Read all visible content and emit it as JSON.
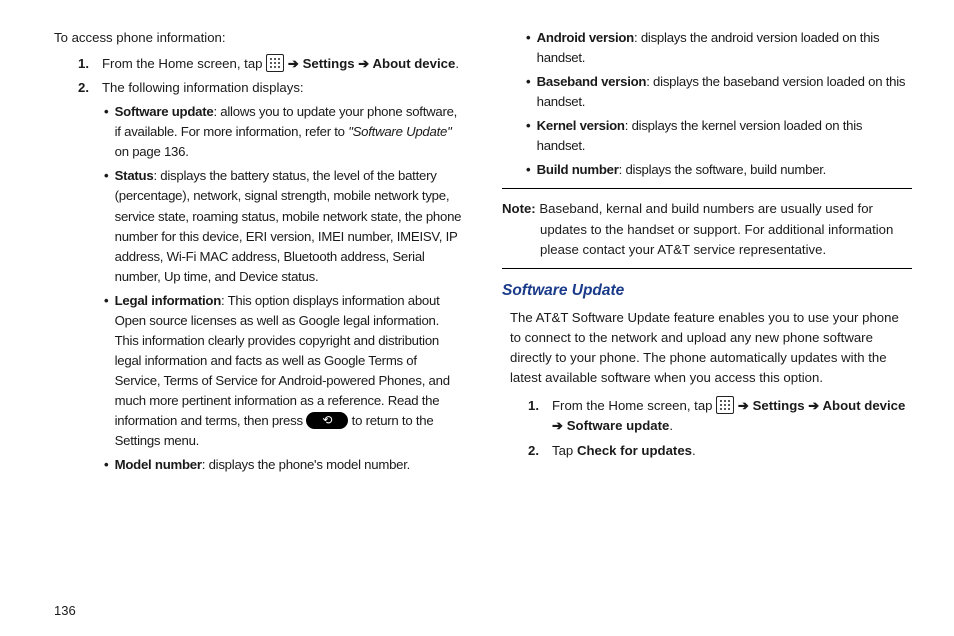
{
  "page_number": "136",
  "left": {
    "intro": "To access phone information:",
    "step1_pre": "From the Home screen, tap ",
    "step1_post1": " Settings ",
    "step1_post2": " About device",
    "step2": "The following information displays:",
    "bullets": [
      {
        "label": "Software update",
        "text": ": allows you to update your phone software, if available. For more information, refer to ",
        "ref": "\"Software Update\"",
        "tail": " on page 136."
      },
      {
        "label": "Status",
        "text": ": displays the battery status, the level of the battery (percentage), network, signal strength, mobile network type, service state, roaming status, mobile network state, the phone number for this device, ERI version, IMEI number, IMEISV, IP address, Wi-Fi MAC address, Bluetooth address, Serial number, Up time, and Device status."
      },
      {
        "label": "Legal information",
        "text": ": This option displays information about Open source licenses as well as Google legal information. This information clearly provides copyright and distribution legal information and facts as well as Google Terms of Service, Terms of Service for Android-powered Phones, and much more pertinent information as a reference. Read the information and terms, then press ",
        "tail2": " to return to the Settings menu."
      },
      {
        "label": "Model number",
        "text": ": displays the phone's model number."
      }
    ]
  },
  "right": {
    "bullets": [
      {
        "label": "Android version",
        "text": ": displays the android version loaded on this handset."
      },
      {
        "label": "Baseband version",
        "text": ": displays the baseband version loaded on this handset."
      },
      {
        "label": "Kernel version",
        "text": ": displays the kernel version loaded on this handset."
      },
      {
        "label": "Build number",
        "text": ": displays the software, build number."
      }
    ],
    "note_label": "Note:",
    "note_text": " Baseband, kernal and build numbers are usually used for updates to the handset or support. For additional information please contact your AT&T service representative.",
    "heading": "Software Update",
    "para": "The AT&T Software Update feature enables you to use your phone to connect to the network and upload any new phone software directly to your phone. The phone automatically updates with the latest available software when you access this option.",
    "step1_pre": "From the Home screen, tap ",
    "step1_mid1": " Settings ",
    "step1_mid2": " About device ",
    "step1_mid3": " Software update",
    "step2_pre": "Tap ",
    "step2_bold": "Check for updates"
  }
}
